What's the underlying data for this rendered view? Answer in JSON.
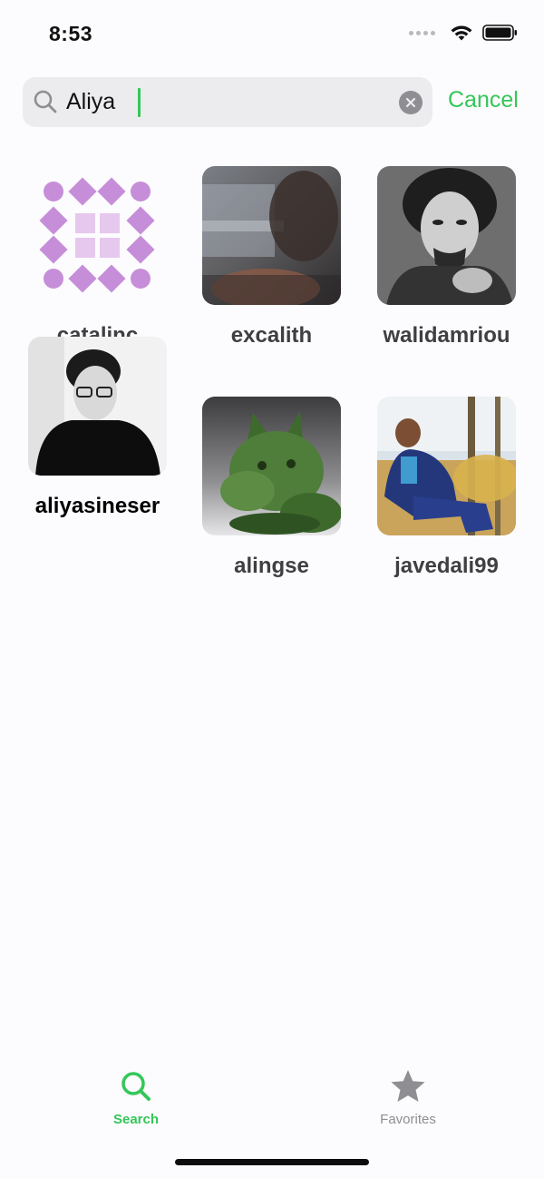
{
  "status_bar": {
    "time": "8:53"
  },
  "search": {
    "query": "Aliya",
    "cancel_label": "Cancel"
  },
  "results": [
    {
      "username": "catalinc",
      "avatar": "purple-pattern-avatar"
    },
    {
      "username": "excalith",
      "avatar": "blurred-portrait-avatar"
    },
    {
      "username": "walidamriou",
      "avatar": "bw-portrait-avatar"
    },
    {
      "username": "aliyasineser",
      "avatar": "bw-glasses-portrait-avatar"
    },
    {
      "username": "alingse",
      "avatar": "green-ceramic-dog-avatar"
    },
    {
      "username": "javedali99",
      "avatar": "outdoor-portrait-avatar"
    }
  ],
  "tab_bar": {
    "search_label": "Search",
    "favorites_label": "Favorites",
    "active_tab": "Search"
  },
  "colors": {
    "accent": "#34c759",
    "background": "#fcfbfd",
    "search_field": "#ececef",
    "inactive_tab": "#8e8e93"
  }
}
